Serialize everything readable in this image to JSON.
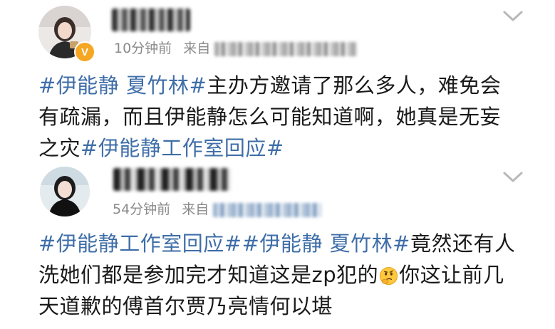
{
  "posts": [
    {
      "time": "10分钟前",
      "source_prefix": "来自",
      "verified_badge": "V",
      "lines": [
        [
          {
            "t": "#伊能静 夏竹林#",
            "tag": true
          },
          {
            "t": "主办方邀请了那么多人，难免会",
            "tag": false
          }
        ],
        [
          {
            "t": "有疏漏，而且伊能静怎么可能知道啊，她真是无妄",
            "tag": false
          }
        ],
        [
          {
            "t": "之灾",
            "tag": false
          },
          {
            "t": "#伊能静工作室回应#",
            "tag": true
          }
        ]
      ]
    },
    {
      "time": "54分钟前",
      "source_prefix": "来自",
      "lines": [
        [
          {
            "t": "#伊能静工作室回应#",
            "tag": true
          },
          {
            "t": "#伊能静 夏竹林#",
            "tag": true
          },
          {
            "t": "竟然还有人",
            "tag": false
          }
        ],
        [
          {
            "t": "洗她们都是参加完才知道这是zp犯的",
            "tag": false
          },
          {
            "emoji": "thinking-face-emoji"
          },
          {
            "t": "你这让前几",
            "tag": false
          }
        ],
        [
          {
            "t": "天道歉的傅首尔贾乃亮情何以堪",
            "tag": false
          }
        ]
      ]
    }
  ],
  "colors": {
    "topic_tag": "#3f6ea8",
    "meta_text": "#8a8a8a",
    "body_text": "#1a1a1a",
    "verified_badge": "#f5a623"
  },
  "icons": [
    "chevron-down-icon",
    "verified-badge-icon",
    "thinking-face-emoji"
  ]
}
